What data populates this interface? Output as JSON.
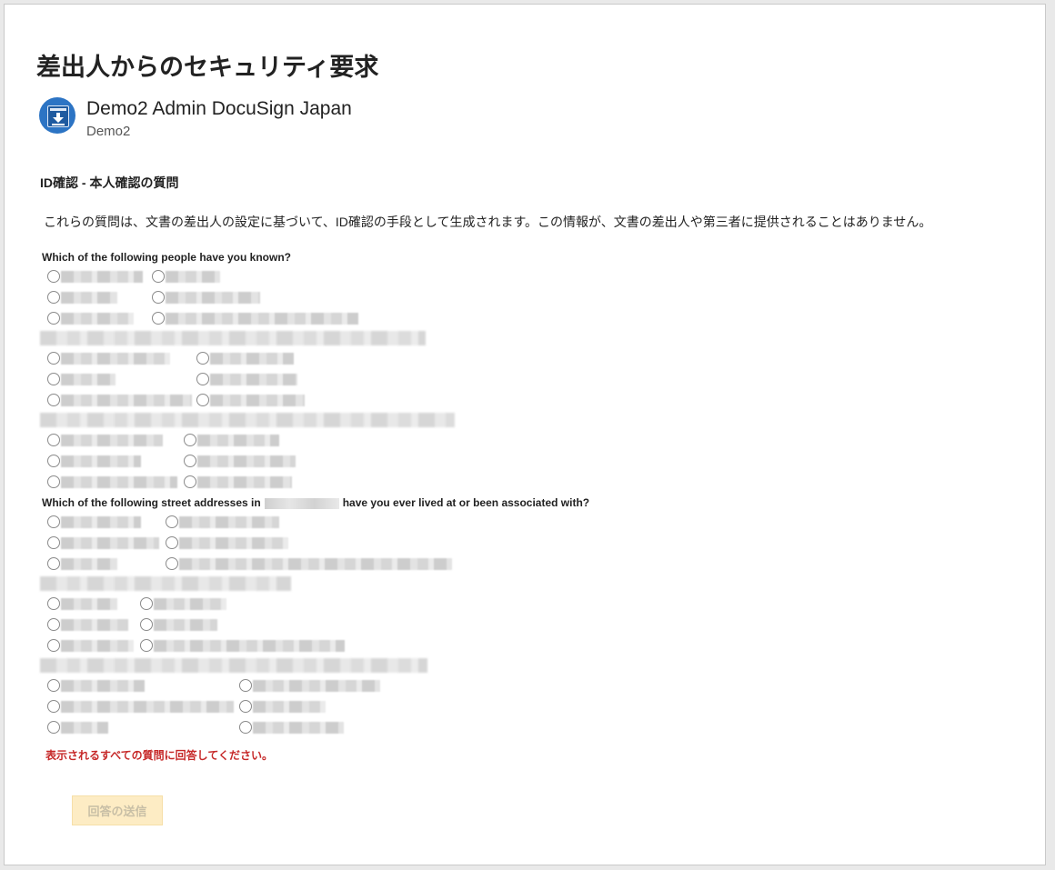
{
  "dialog": {
    "title": "差出人からのセキュリティ要求",
    "sender": {
      "name": "Demo2 Admin DocuSign Japan",
      "subtitle": "Demo2"
    },
    "section_heading": "ID確認 - 本人確認の質問",
    "description": "これらの質問は、文書の差出人の設定に基づいて、ID確認の手段として生成されます。この情報が、文書の差出人や第三者に提供されることはありません。",
    "questions": [
      {
        "text": "Which of the following people have you known?"
      },
      {
        "text_before": "Which of the following street addresses in",
        "text_after": "have you ever lived at or been associated with?"
      }
    ],
    "error_message": "表示されるすべての質問に回答してください。",
    "submit_label": "回答の送信"
  },
  "colors": {
    "error": "#c62828",
    "submit_bg": "#fdecc4",
    "avatar": "#2c74c4"
  }
}
